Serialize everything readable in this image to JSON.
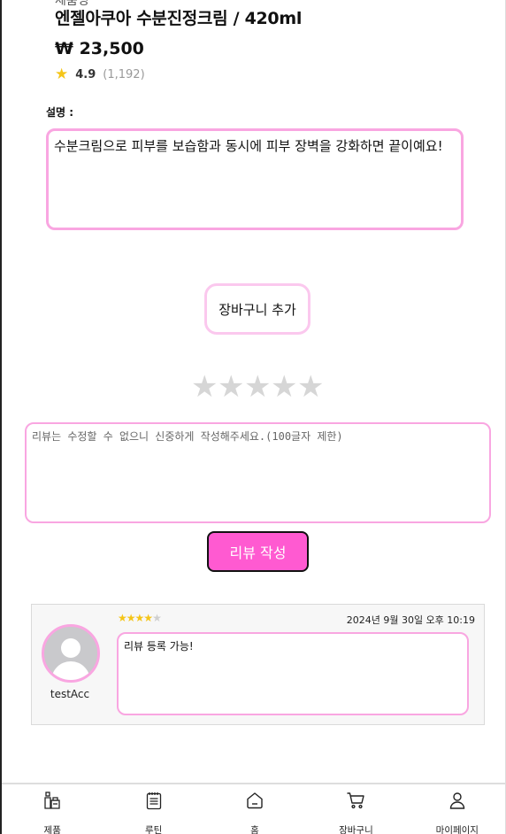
{
  "product": {
    "cut_text": "제품명",
    "name": "엔젤아쿠아 수분진정크림 / 420ml",
    "price": "₩ 23,500",
    "rating_score": "4.9",
    "rating_count": "(1,192)"
  },
  "description": {
    "label": "설명 :",
    "text": "수분크림으로 피부를 보습함과 동시에 피부 장벽을 강화하면 끝이예요!"
  },
  "actions": {
    "add_to_cart_label": "장바구니 추가",
    "submit_review_label": "리뷰 작성"
  },
  "review_form": {
    "rating": 0,
    "max_rating": 5,
    "placeholder": "리뷰는 수정할 수 없으니 신중하게 작성해주세요.(100글자 제한)"
  },
  "reviews": [
    {
      "username": "testAcc",
      "rating": 4,
      "max_rating": 5,
      "date": "2024년 9월 30일 오후 10:19",
      "text": "리뷰 등록 가능!"
    }
  ],
  "nav": {
    "items": [
      {
        "label": "제품",
        "icon": "product-bottle-icon"
      },
      {
        "label": "루틴",
        "icon": "notepad-icon"
      },
      {
        "label": "홈",
        "icon": "home-icon"
      },
      {
        "label": "장바구니",
        "icon": "cart-icon"
      },
      {
        "label": "마이페이지",
        "icon": "user-icon"
      }
    ]
  },
  "colors": {
    "accent_pink": "#ff5ad1",
    "border_pink": "#f9a6e1",
    "star_yellow": "#f5c518",
    "star_empty": "#d6d6d6"
  }
}
